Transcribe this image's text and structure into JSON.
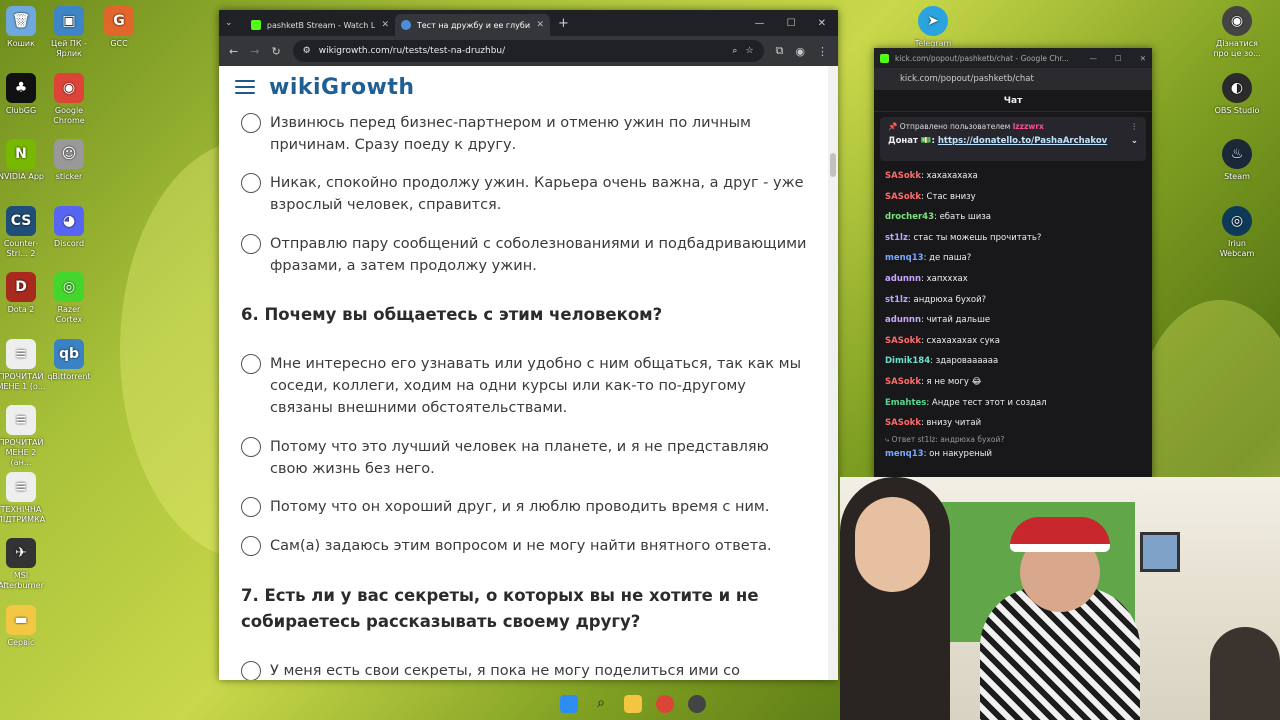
{
  "desktop_left": [
    {
      "label": "Кошик",
      "icon": "recycle-bin-icon",
      "color": "#6fa8dc",
      "glyph": "🗑"
    },
    {
      "label": "Цей ПК - Ярлик",
      "icon": "this-pc-icon",
      "color": "#3d85c6",
      "glyph": "▣"
    },
    {
      "label": "GCC",
      "icon": "gcc-icon",
      "color": "#e0662b",
      "glyph": "G"
    },
    {
      "label": "ClubGG",
      "icon": "clubgg-icon",
      "color": "#111111",
      "glyph": "♣"
    },
    {
      "label": "Google Chrome",
      "icon": "chrome-icon",
      "color": "#db4437",
      "glyph": "◉"
    },
    {
      "label": "NVIDIA App",
      "icon": "nvidia-icon",
      "color": "#76b900",
      "glyph": "N"
    },
    {
      "label": "sticker",
      "icon": "sticker-icon",
      "color": "#999999",
      "glyph": "☺"
    },
    {
      "label": "Counter-Stri... 2",
      "icon": "cs2-icon",
      "color": "#1f4e79",
      "glyph": "CS"
    },
    {
      "label": "Discord",
      "icon": "discord-icon",
      "color": "#5865f2",
      "glyph": "◕"
    },
    {
      "label": "Dota 2",
      "icon": "dota2-icon",
      "color": "#a82a1e",
      "glyph": "D"
    },
    {
      "label": "Razer Cortex",
      "icon": "razer-cortex-icon",
      "color": "#44d62c",
      "glyph": "◎"
    },
    {
      "label": "ПРОЧИТАЙ МЕНЕ 1 (о...",
      "icon": "document-icon",
      "color": "#eeeeee",
      "glyph": "≡"
    },
    {
      "label": "qBittorrent",
      "icon": "qbittorrent-icon",
      "color": "#3b82c4",
      "glyph": "qb"
    },
    {
      "label": "ПРОЧИТАЙ МЕНЕ 2 (ан...",
      "icon": "document-icon",
      "color": "#eeeeee",
      "glyph": "≡"
    },
    {
      "label": "ТЕХНІЧНА ПІДТРИМКА",
      "icon": "document-icon",
      "color": "#eeeeee",
      "glyph": "≡"
    },
    {
      "label": "MSI Afterburner",
      "icon": "msi-afterburner-icon",
      "color": "#333333",
      "glyph": "✈"
    },
    {
      "label": "Сервіс",
      "icon": "folder-icon",
      "color": "#f2c744",
      "glyph": "▬"
    }
  ],
  "desktop_right": [
    {
      "label": "Telegram",
      "icon": "telegram-icon",
      "color": "#2aa3df",
      "glyph": "➤"
    },
    {
      "label": "Дізнатися про це зо...",
      "icon": "spotlight-icon",
      "color": "#444444",
      "glyph": "◉"
    },
    {
      "label": "OBS Studio",
      "icon": "obs-icon",
      "color": "#2b2b2b",
      "glyph": "◐"
    },
    {
      "label": "Steam",
      "icon": "steam-icon",
      "color": "#1b2838",
      "glyph": "♨"
    },
    {
      "label": "Iriun Webcam",
      "icon": "iriun-webcam-icon",
      "color": "#0f3a57",
      "glyph": "◎"
    }
  ],
  "browser": {
    "tabs": [
      {
        "title": "pashketB Stream - Watch Live o",
        "active": false
      },
      {
        "title": "Тест на дружбу и ее глубину",
        "active": true
      }
    ],
    "url": "wikigrowth.com/ru/tests/test-na-druzhbu/"
  },
  "site": {
    "logo": "wikiGrowth"
  },
  "quiz": {
    "options_prev": [
      "Извинюсь перед бизнес-партнером и отменю ужин по личным причинам. Сразу поеду к другу.",
      "Никак, спокойно продолжу ужин. Карьера очень важна, а друг - уже взрослый человек, справится.",
      "Отправлю пару сообщений с соболезнованиями и подбадривающими фразами, а затем продолжу ужин."
    ],
    "q6": "6. Почему вы общаетесь с этим человеком?",
    "q6_options": [
      "Мне интересно его узнавать или удобно с ним общаться, так как мы соседи, коллеги, ходим на одни курсы или как-то по-другому связаны внешними обстоятельствами.",
      "Потому что это лучший человек на планете, и я не представляю свою жизнь без него.",
      "Потому что он хороший друг, и я люблю проводить время с ним.",
      "Сам(а) задаюсь этим вопросом и не могу найти внятного ответа."
    ],
    "q7": "7. Есть ли у вас секреты, о которых вы не хотите и не собираетесь рассказывать своему другу?",
    "q7_option1": "У меня есть свои секреты, я пока не могу поделиться ими со"
  },
  "chat": {
    "window_title": "kick.com/popout/pashketb/chat - Google Chr...",
    "url": "kick.com/popout/pashketb/chat",
    "header": "Чат",
    "pinned_by": "Отправлено пользователем",
    "pinned_user": "lzzzwrx",
    "pinned_label": "Донат",
    "pinned_link": "https://donatello.to/PashaArchakov",
    "messages": [
      {
        "user": "SASokk",
        "color": "#ff6b6b",
        "text": "хахахахаха"
      },
      {
        "user": "SASokk",
        "color": "#ff6b6b",
        "text": "Стас внизу"
      },
      {
        "user": "drocher43",
        "color": "#7ee37e",
        "text": "ебать шиза"
      },
      {
        "user": "st1lz",
        "color": "#b9a6ff",
        "text": "стас ты можешь прочитать?"
      },
      {
        "user": "menq13",
        "color": "#7aa7ff",
        "text": "де паша?"
      },
      {
        "user": "adunnn",
        "color": "#c8a6ff",
        "text": "хапхххах"
      },
      {
        "user": "st1lz",
        "color": "#b9a6ff",
        "text": "андрюха бухой?"
      },
      {
        "user": "adunnn",
        "color": "#c8a6ff",
        "text": "читай дальше"
      },
      {
        "user": "SASokk",
        "color": "#ff6b6b",
        "text": "схахахахах сука"
      },
      {
        "user": "Dimik184",
        "color": "#6fe0c8",
        "text": "здароваааааа"
      },
      {
        "user": "SASokk",
        "color": "#ff6b6b",
        "text": "я не могу 😂"
      },
      {
        "user": "Emahtes",
        "color": "#58d68d",
        "text": "Андре тест этот и создал"
      },
      {
        "user": "SASokk",
        "color": "#ff6b6b",
        "text": "внизу читай"
      }
    ],
    "reply_note": "Ответ st1lz: андрюха бухой?",
    "last_message": {
      "user": "menq13",
      "color": "#7aa7ff",
      "text": "он накуреный"
    }
  }
}
